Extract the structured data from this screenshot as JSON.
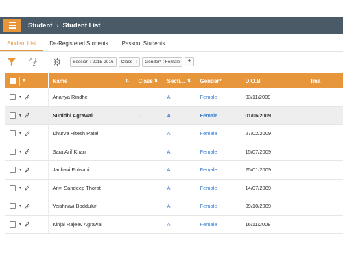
{
  "breadcrumb": {
    "root": "Student",
    "current": "Student List"
  },
  "tabs": [
    {
      "label": "Student List"
    },
    {
      "label": "De-Registered Students"
    },
    {
      "label": "Passout Students"
    }
  ],
  "filters": {
    "session": "Session : 2015-2016",
    "class": "Class : I",
    "gender": "Gender* : Female"
  },
  "columns": {
    "name": "Name",
    "class": "Class",
    "section": "Secti...",
    "gender": "Gender*",
    "dob": "D.O.B",
    "image": "Ima"
  },
  "rows": [
    {
      "name": "Ananya Rindhe",
      "class": "I",
      "section": "A",
      "gender": "Female",
      "dob": "03/11/2009"
    },
    {
      "name": "Sunidhi Agrawal",
      "class": "I",
      "section": "A",
      "gender": "Female",
      "dob": "01/06/2009"
    },
    {
      "name": "Dhurva Hitesh Patel",
      "class": "I",
      "section": "A",
      "gender": "Female",
      "dob": "27/02/2009"
    },
    {
      "name": "Sara Arif Khan",
      "class": "I",
      "section": "A",
      "gender": "Female",
      "dob": "15/07/2009"
    },
    {
      "name": "Janhavi Fulwani",
      "class": "I",
      "section": "A",
      "gender": "Female",
      "dob": "25/01/2009"
    },
    {
      "name": "Anvi Sandeep Thorat",
      "class": "I",
      "section": "A",
      "gender": "Female",
      "dob": "14/07/2009"
    },
    {
      "name": "Vaishnavi Bodduluri",
      "class": "I",
      "section": "A",
      "gender": "Female",
      "dob": "09/10/2009"
    },
    {
      "name": "Kinjal Rajeev Agrawal",
      "class": "I",
      "section": "A",
      "gender": "Female",
      "dob": "16/11/2008"
    }
  ],
  "colors": {
    "accent": "#e8963c",
    "header_bar": "#4a5a66",
    "link": "#3a7fd0"
  },
  "icons": [
    "menu-icon",
    "filter-icon",
    "sort-az-icon",
    "settings-icon",
    "plus-icon",
    "edit-icon",
    "chevron-down-icon"
  ]
}
